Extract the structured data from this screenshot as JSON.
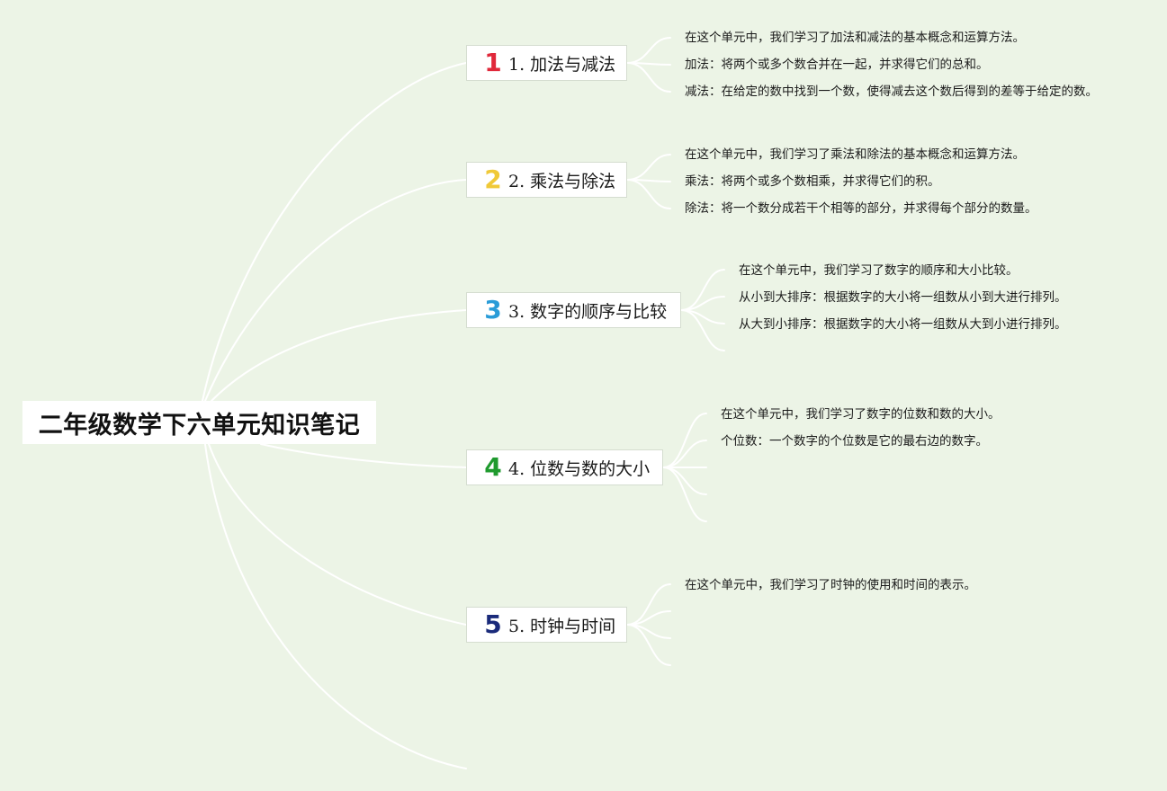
{
  "root": {
    "label": "二年级数学下六单元知识笔记"
  },
  "colors": {
    "background": "#ecf4e6",
    "connector": "#ffffff",
    "num1": "#e0283a",
    "num2": "#f0c938",
    "num3": "#2a9cd8",
    "num4": "#1f9a2e",
    "num5": "#1a2a7a"
  },
  "topics": [
    {
      "icon": "number-1-icon",
      "number": "1",
      "label": "1. 加法与减法",
      "notes": [
        "在这个单元中，我们学习了加法和减法的基本概念和运算方法。",
        "加法：将两个或多个数合并在一起，并求得它们的总和。",
        "减法：在给定的数中找到一个数，使得减去这个数后得到的差等于给定的数。"
      ]
    },
    {
      "icon": "number-2-icon",
      "number": "2",
      "label": "2. 乘法与除法",
      "notes": [
        "在这个单元中，我们学习了乘法和除法的基本概念和运算方法。",
        "乘法：将两个或多个数相乘，并求得它们的积。",
        "除法：将一个数分成若干个相等的部分，并求得每个部分的数量。"
      ]
    },
    {
      "icon": "number-3-icon",
      "number": "3",
      "label": "3. 数字的顺序与比较",
      "notes": [
        "在这个单元中，我们学习了数字的顺序和大小比较。",
        "从小到大排序：根据数字的大小将一组数从小到大进行排列。",
        "从大到小排序：根据数字的大小将一组数从大到小进行排列。"
      ]
    },
    {
      "icon": "number-4-icon",
      "number": "4",
      "label": "4. 位数与数的大小",
      "notes": [
        "在这个单元中，我们学习了数字的位数和数的大小。",
        "个位数：一个数字的个位数是它的最右边的数字。"
      ]
    },
    {
      "icon": "number-5-icon",
      "number": "5",
      "label": "5. 时钟与时间",
      "notes": [
        "在这个单元中，我们学习了时钟的使用和时间的表示。"
      ]
    }
  ]
}
